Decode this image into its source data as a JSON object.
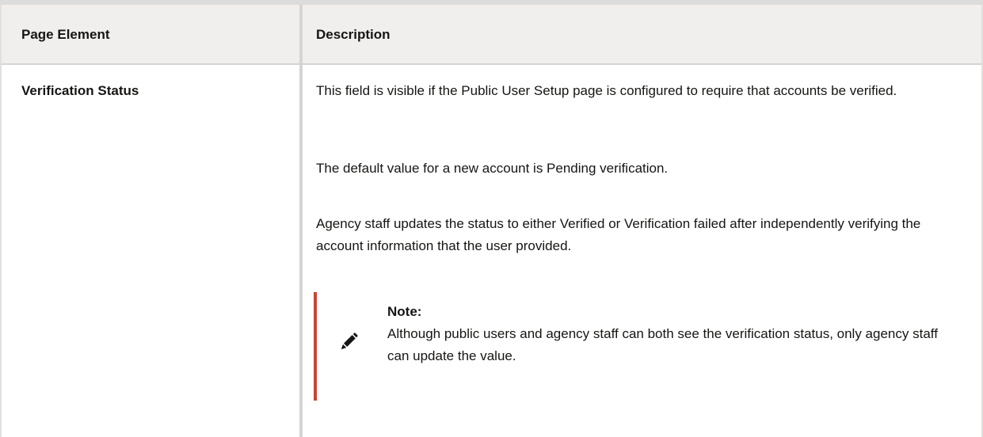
{
  "table": {
    "headers": [
      "Page Element",
      "Description"
    ],
    "rows": [
      {
        "element": "Verification Status",
        "paragraphs": [
          "This field is visible if the Public User Setup page is configured to require that accounts be verified.",
          "The default value for a new account is Pending verification.",
          "Agency staff updates the status to either Verified or Verification failed after independently verifying the account information that the user provided."
        ],
        "note": {
          "icon": "pencil-icon",
          "title": "Note:",
          "text": "Although public users and agency staff can both see the verification status, only agency staff can update the value."
        }
      }
    ]
  },
  "colors": {
    "header_bg": "#f1efed",
    "border": "#d6d4d2",
    "note_accent": "#c74634",
    "text": "#161513"
  }
}
